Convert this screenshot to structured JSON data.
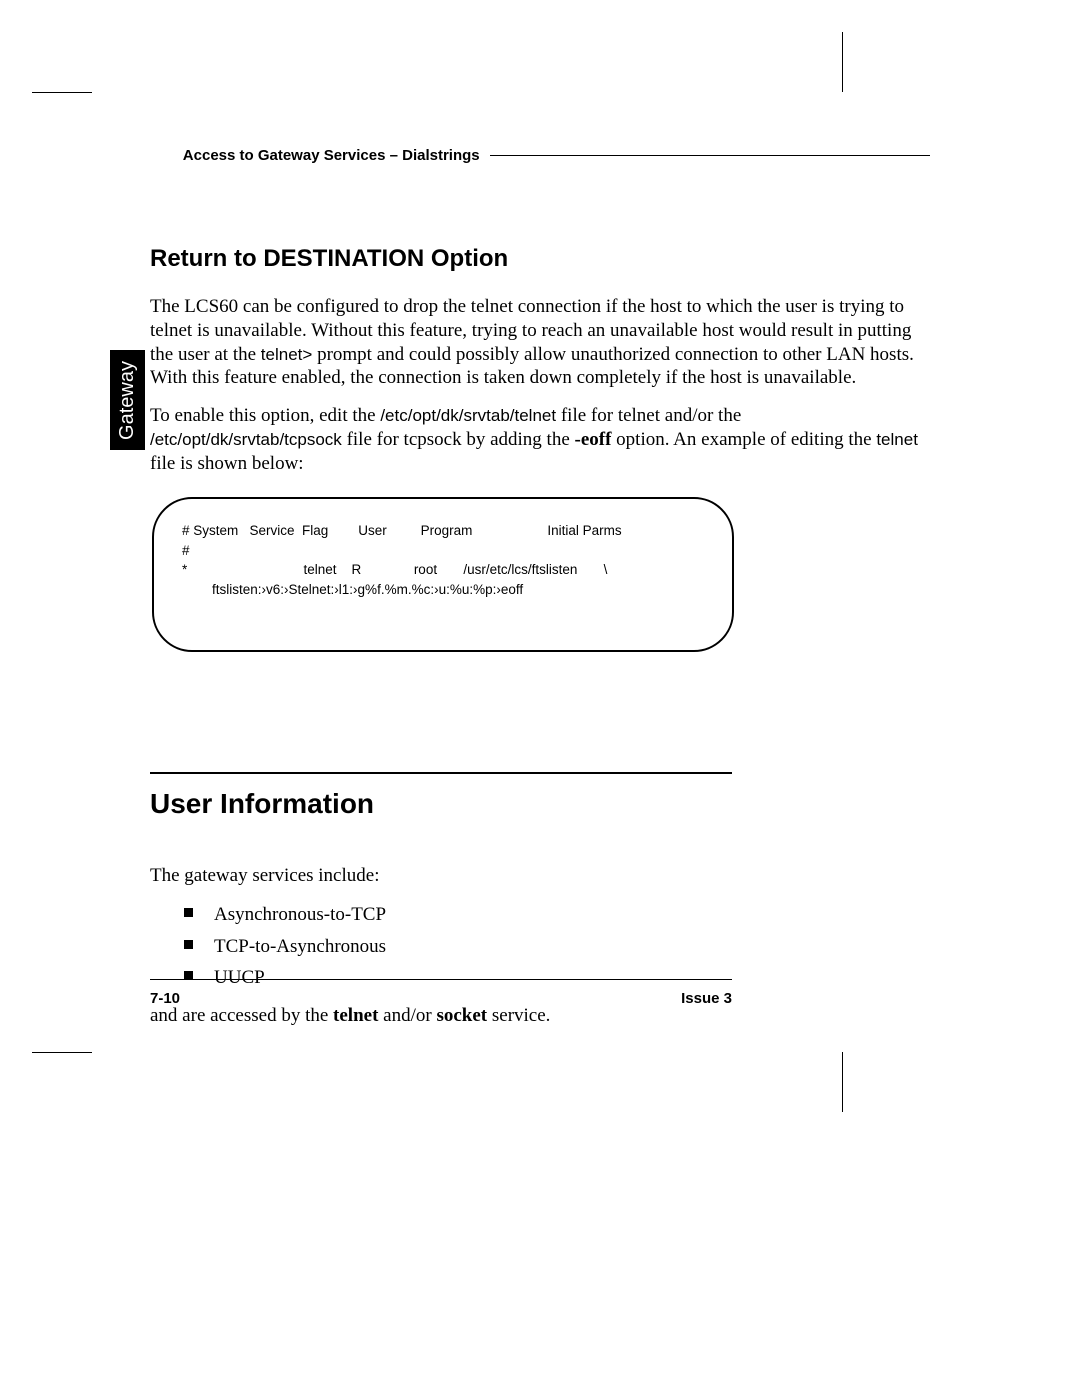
{
  "header": {
    "section": "Access to Gateway Services",
    "separator": " – ",
    "subsection": "Dialstrings"
  },
  "sidebar_tab": "Gateway",
  "return_section": {
    "heading": "Return to DESTINATION Option",
    "para1_a": "The LCS60 can be configured to drop the telnet connection if the host to which the user is trying to telnet is unavailable. Without this feature, trying to reach an unavailable host would result in putting the user at the ",
    "para1_prompt": "telnet>",
    "para1_b": " prompt and could possibly allow unauthorized connection to other LAN hosts. With this feature enabled, the connection is taken down completely if the host is unavailable.",
    "para2_a": "To enable this option, edit the ",
    "para2_path1": "/etc/opt/dk/srvtab/telnet",
    "para2_b": " file for telnet and/or the ",
    "para2_path2": "/etc/opt/dk/srvtab/tcpsock",
    "para2_c": " file for tcpsock by adding the ",
    "para2_opt": "-eoff",
    "para2_d": " option. An example of editing the ",
    "para2_path3": "telnet",
    "para2_e": " file is shown below:"
  },
  "code_block": {
    "line1": "# System   Service  Flag        User         Program                    Initial Parms",
    "line2": "#",
    "line3": "*                               telnet    R              root       /usr/etc/lcs/ftslisten       \\",
    "line4": "        ftslisten:›v6:›Stelnet:›l1:›g%f.%m.%c:›u:%u:%p:›eoff"
  },
  "user_info": {
    "heading": "User Information",
    "intro": "The gateway services include:",
    "items": [
      "Asynchronous-to-TCP",
      "TCP-to-Asynchronous",
      "UUCP"
    ],
    "outro_a": "and are accessed by the ",
    "outro_b": "telnet",
    "outro_c": " and/or ",
    "outro_d": "socket",
    "outro_e": " service."
  },
  "footer": {
    "left": "7-10",
    "right": "Issue 3"
  }
}
